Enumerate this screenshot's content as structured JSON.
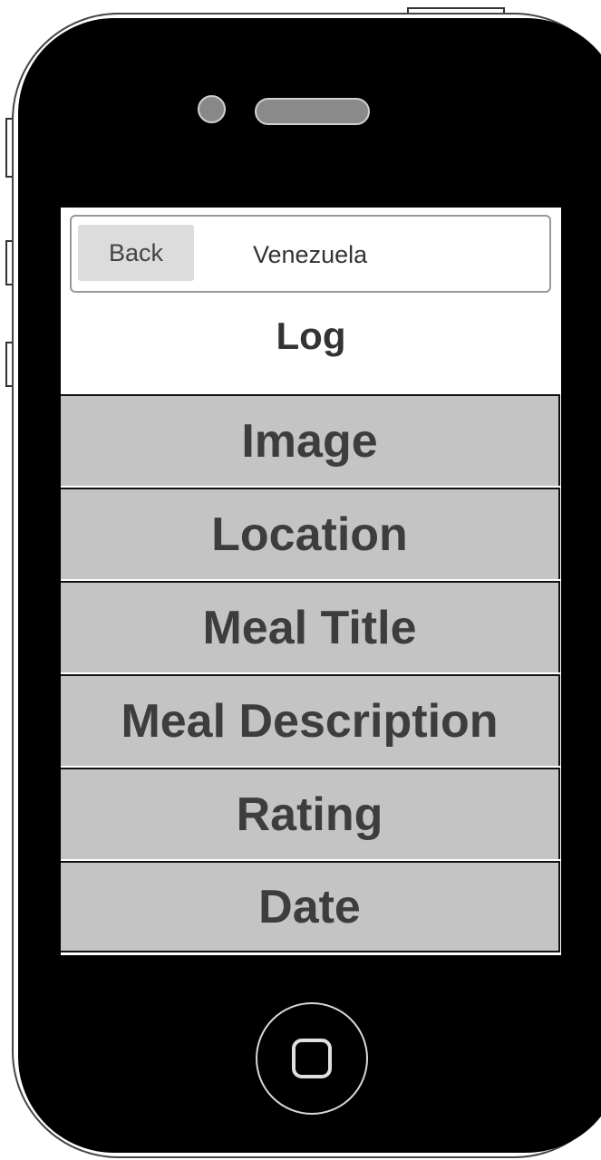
{
  "navbar": {
    "back_label": "Back",
    "title": "Venezuela"
  },
  "page": {
    "title": "Log"
  },
  "list": {
    "items": [
      {
        "label": "Image"
      },
      {
        "label": "Location"
      },
      {
        "label": "Meal Title"
      },
      {
        "label": "Meal Description"
      },
      {
        "label": "Rating"
      },
      {
        "label": "Date"
      }
    ]
  },
  "colors": {
    "device_body": "#000000",
    "list_item_bg": "#c4c4c4",
    "back_button_bg": "#dcdcdc",
    "text": "#3d3d3d"
  },
  "icons": {
    "camera": "camera-icon",
    "speaker": "speaker-icon",
    "home": "home-button-icon"
  }
}
